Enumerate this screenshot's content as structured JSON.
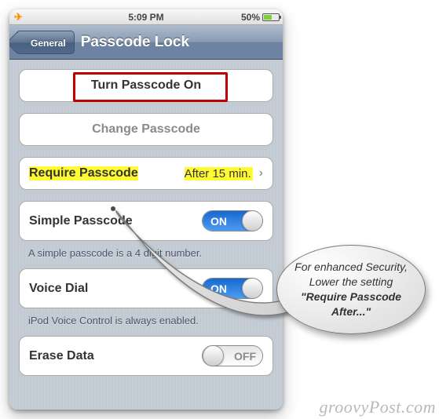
{
  "status": {
    "time": "5:09 PM",
    "battery_pct": "50%",
    "airplane_mode": true
  },
  "nav": {
    "back_label": "General",
    "title": "Passcode Lock"
  },
  "cells": {
    "turn_on": "Turn Passcode On",
    "change": "Change Passcode",
    "require_label": "Require Passcode",
    "require_value": "After 15 min.",
    "simple_label": "Simple Passcode",
    "simple_footer": "A simple passcode is a 4 digit number.",
    "voice_label": "Voice Dial",
    "voice_footer": "iPod Voice Control is always enabled.",
    "erase_label": "Erase Data"
  },
  "toggle": {
    "on_text": "ON",
    "off_text": "OFF",
    "simple_state": "on",
    "voice_state": "on",
    "erase_state": "off"
  },
  "callout": {
    "line1": "For enhanced Security, Lower the setting ",
    "bold": "\"Require Passcode After...\""
  },
  "watermark": "groovyPost.com"
}
